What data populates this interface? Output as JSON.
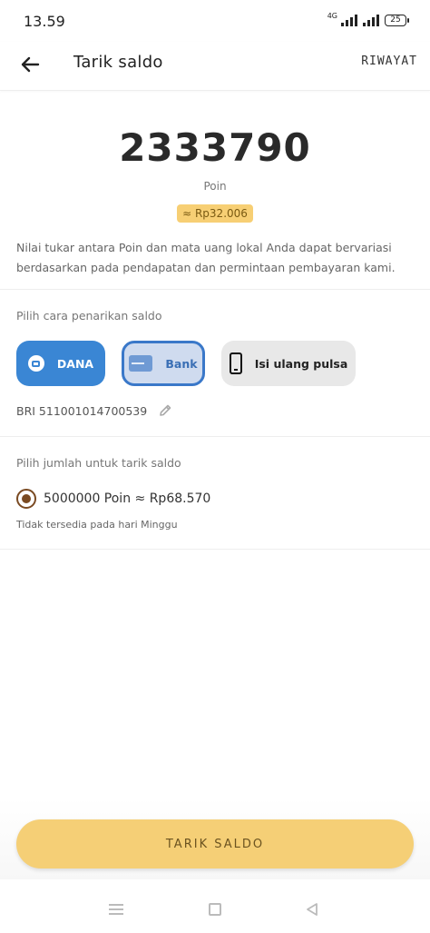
{
  "status_bar": {
    "time": "13.59",
    "network": "4G",
    "battery": "25"
  },
  "app_bar": {
    "title": "Tarik saldo",
    "history_label": "RIWAYAT"
  },
  "balance": {
    "points": "2333790",
    "unit_label": "Poin",
    "approx_value": "≈ Rp32.006",
    "info": "Nilai tukar antara Poin dan mata uang lokal Anda dapat bervariasi berdasarkan pada pendapatan dan permintaan pembayaran kami."
  },
  "withdraw_method": {
    "section_label": "Pilih cara penarikan saldo",
    "options": [
      {
        "label": "DANA",
        "icon": "wallet-icon",
        "selected": false
      },
      {
        "label": "Bank",
        "icon": "bank-card-icon",
        "selected": true
      },
      {
        "label": "Isi ulang pulsa",
        "icon": "phone-icon",
        "selected": false
      }
    ],
    "account": "BRI 511001014700539"
  },
  "withdraw_amount": {
    "section_label": "Pilih jumlah untuk tarik saldo",
    "option_label": "5000000 Poin ≈ Rp68.570",
    "option_selected": true,
    "note": "Tidak tersedia pada hari Minggu"
  },
  "action": {
    "withdraw_label": "TARIK SALDO"
  },
  "colors": {
    "accent_yellow": "#f5cf76",
    "dana_blue": "#3a86d4",
    "bank_border": "#3a78c9",
    "radio_brown": "#7a4a22"
  }
}
